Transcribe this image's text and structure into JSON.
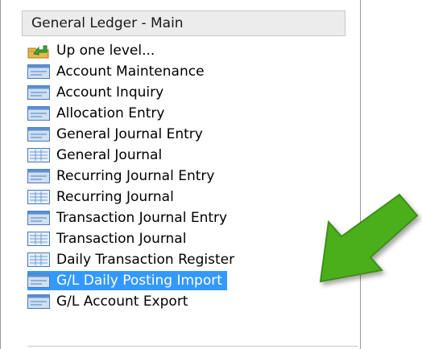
{
  "panel": {
    "title": "General Ledger - Main",
    "items": [
      {
        "label": "Up one level...",
        "icon": "up-folder-icon",
        "selected": false
      },
      {
        "label": "Account Maintenance",
        "icon": "form-icon",
        "selected": false
      },
      {
        "label": "Account Inquiry",
        "icon": "form-icon",
        "selected": false
      },
      {
        "label": "Allocation Entry",
        "icon": "form-icon",
        "selected": false
      },
      {
        "label": "General Journal Entry",
        "icon": "form-icon",
        "selected": false
      },
      {
        "label": "General Journal",
        "icon": "report-icon",
        "selected": false
      },
      {
        "label": "Recurring Journal Entry",
        "icon": "form-icon",
        "selected": false
      },
      {
        "label": "Recurring Journal",
        "icon": "report-icon",
        "selected": false
      },
      {
        "label": "Transaction Journal Entry",
        "icon": "form-icon",
        "selected": false
      },
      {
        "label": "Transaction Journal",
        "icon": "report-icon",
        "selected": false
      },
      {
        "label": "Daily Transaction Register",
        "icon": "report-icon",
        "selected": false
      },
      {
        "label": "G/L Daily Posting Import",
        "icon": "form-icon",
        "selected": true
      },
      {
        "label": "G/L Account Export",
        "icon": "form-icon",
        "selected": false
      }
    ]
  },
  "colors": {
    "selection": "#3399ff",
    "arrow": "#4caf1f"
  }
}
